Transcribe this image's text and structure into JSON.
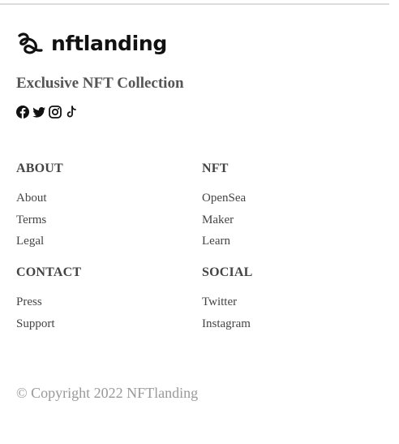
{
  "brand": {
    "name": "nftlanding",
    "tagline": "Exclusive NFT Collection"
  },
  "social_icons": [
    "facebook-icon",
    "twitter-icon",
    "instagram-icon",
    "tiktok-icon"
  ],
  "sections": {
    "about": {
      "title": "ABOUT",
      "links": [
        "About",
        "Terms",
        "Legal"
      ]
    },
    "nft": {
      "title": "NFT",
      "links": [
        "OpenSea",
        "Maker",
        "Learn"
      ]
    },
    "contact": {
      "title": "CONTACT",
      "links": [
        "Press",
        "Support"
      ]
    },
    "social": {
      "title": "SOCIAL",
      "links": [
        "Twitter",
        "Instagram"
      ]
    }
  },
  "copyright": "© Copyright 2022 NFTlanding"
}
